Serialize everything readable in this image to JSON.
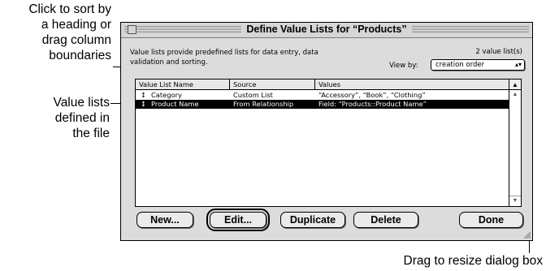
{
  "callouts": {
    "sort": [
      "Click to sort by",
      "a heading or",
      "drag column",
      "boundaries"
    ],
    "lists": [
      "Value lists",
      "defined in",
      "the file"
    ],
    "resize": "Drag to resize dialog box"
  },
  "dialog": {
    "title": "Define Value Lists for “Products”",
    "description": "Value lists provide predefined lists for data entry, data validation and sorting.",
    "count": "2 value list(s)",
    "view_by_label": "View by:",
    "view_by_value": "creation order",
    "columns": [
      "Value List Name",
      "Source",
      "Values"
    ],
    "rows": [
      {
        "name": "Category",
        "source": "Custom List",
        "values": "“Accessory”, “Book”, “Clothing”",
        "selected": false
      },
      {
        "name": "Product Name",
        "source": "From Relationship",
        "values": "Field: “Products::Product Name”",
        "selected": true
      }
    ],
    "buttons": {
      "new": "New...",
      "edit": "Edit...",
      "duplicate": "Duplicate",
      "delete": "Delete",
      "done": "Done"
    }
  }
}
